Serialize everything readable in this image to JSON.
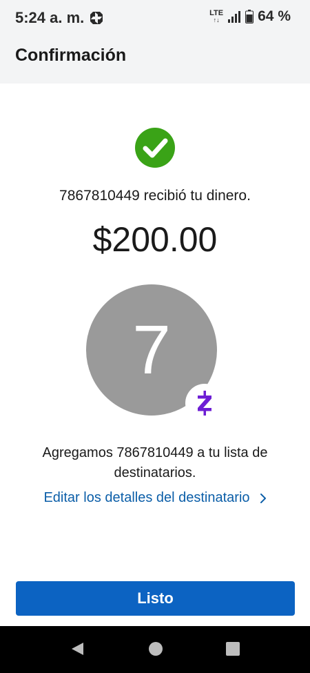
{
  "status_bar": {
    "time": "5:24 a. m.",
    "network": "LTE",
    "battery": "64 %"
  },
  "header": {
    "title": "Confirmación"
  },
  "confirmation": {
    "message": "7867810449 recibió tu dinero.",
    "amount": "$200.00",
    "avatar_initial": "7",
    "added_message": "Agregamos 7867810449 a tu lista de destinatarios.",
    "edit_link": "Editar los detalles del destinatario",
    "done_button": "Listo"
  },
  "colors": {
    "success_green": "#3aa317",
    "link_blue": "#0b5ea8",
    "button_blue": "#0c63c2",
    "zelle_purple": "#6d1ed4",
    "avatar_gray": "#9a9a9a"
  },
  "icons": {
    "success": "check-circle-icon",
    "badge": "zelle-icon",
    "link_arrow": "chevron-right-icon"
  }
}
